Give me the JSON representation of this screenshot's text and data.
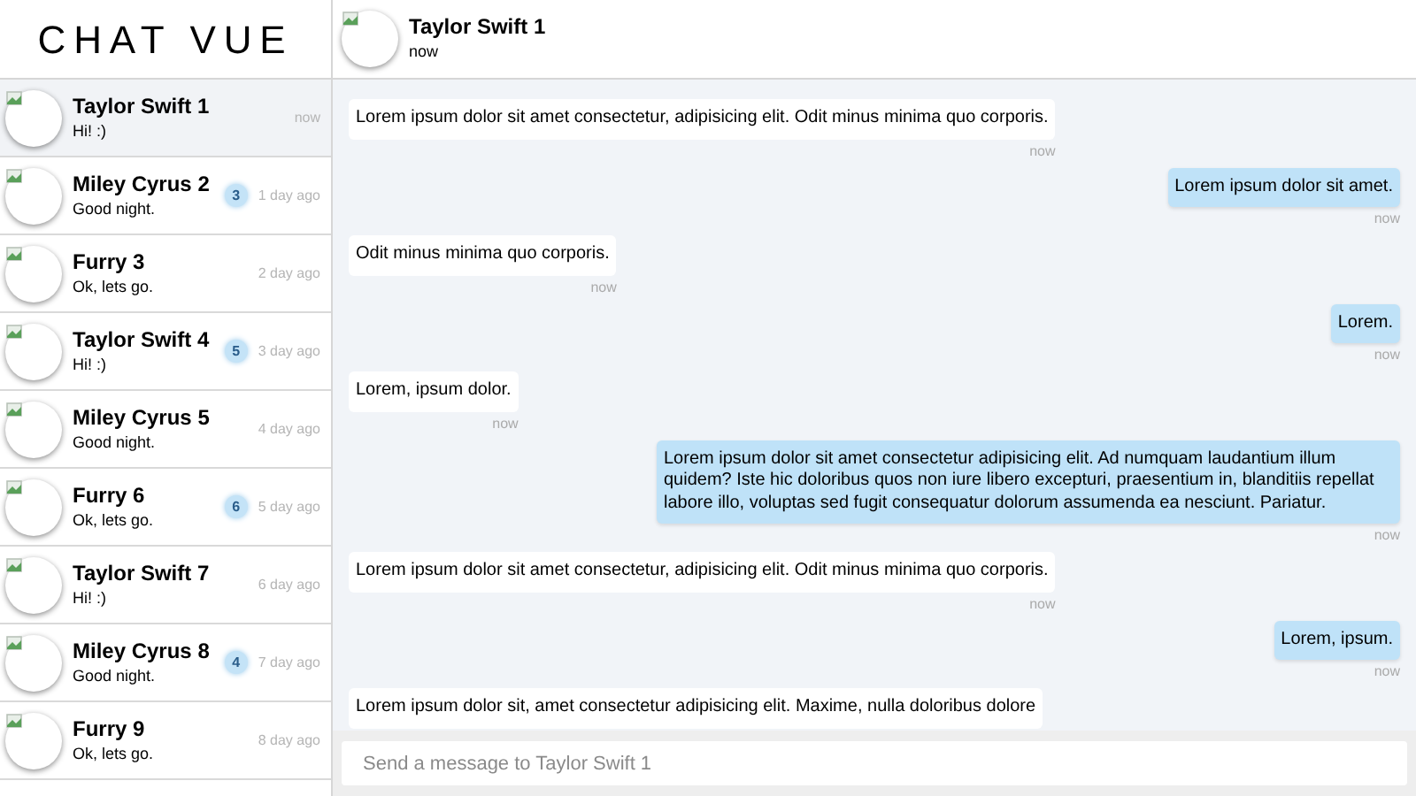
{
  "app_title": "CHAT VUE",
  "contacts": [
    {
      "name": "Taylor Swift 1",
      "last_message": "Hi! :)",
      "time": "now",
      "selected": true
    },
    {
      "name": "Miley Cyrus 2",
      "last_message": "Good night.",
      "time": "1 day ago",
      "unread": "3",
      "selected": false
    },
    {
      "name": "Furry 3",
      "last_message": "Ok, lets go.",
      "time": "2 day ago",
      "selected": false
    },
    {
      "name": "Taylor Swift 4",
      "last_message": "Hi! :)",
      "time": "3 day ago",
      "unread": "5",
      "selected": false
    },
    {
      "name": "Miley Cyrus 5",
      "last_message": "Good night.",
      "time": "4 day ago",
      "selected": false
    },
    {
      "name": "Furry 6",
      "last_message": "Ok, lets go.",
      "time": "5 day ago",
      "unread": "6",
      "selected": false
    },
    {
      "name": "Taylor Swift 7",
      "last_message": "Hi! :)",
      "time": "6 day ago",
      "selected": false
    },
    {
      "name": "Miley Cyrus 8",
      "last_message": "Good night.",
      "time": "7 day ago",
      "unread": "4",
      "selected": false
    },
    {
      "name": "Furry 9",
      "last_message": "Ok, lets go.",
      "time": "8 day ago",
      "selected": false
    }
  ],
  "chat_header": {
    "name": "Taylor Swift 1",
    "status": "now"
  },
  "messages": [
    {
      "kind": "received",
      "text": "Lorem ipsum dolor sit amet consectetur, adipisicing elit. Odit minus minima quo corporis.",
      "time": "now"
    },
    {
      "kind": "sent",
      "text": "Lorem ipsum dolor sit amet.",
      "time": "now"
    },
    {
      "kind": "received",
      "text": "Odit minus minima quo corporis.",
      "time": "now"
    },
    {
      "kind": "sent",
      "text": "Lorem.",
      "time": "now"
    },
    {
      "kind": "received",
      "text": "Lorem, ipsum dolor.",
      "time": "now"
    },
    {
      "kind": "sent",
      "text": "Lorem ipsum dolor sit amet consectetur adipisicing elit. Ad numquam laudantium illum quidem? Iste hic doloribus quos non iure libero excepturi, praesentium in, blanditiis repellat labore illo, voluptas sed fugit consequatur dolorum assumenda ea nesciunt. Pariatur.",
      "time": "now"
    },
    {
      "kind": "received",
      "text": "Lorem ipsum dolor sit amet consectetur, adipisicing elit. Odit minus minima quo corporis.",
      "time": "now"
    },
    {
      "kind": "sent",
      "text": "Lorem, ipsum.",
      "time": "now"
    },
    {
      "kind": "received",
      "text": "Lorem ipsum dolor sit, amet consectetur adipisicing elit. Maxime, nulla doloribus dolore"
    }
  ],
  "composer": {
    "placeholder": "Send a message to Taylor Swift 1"
  }
}
